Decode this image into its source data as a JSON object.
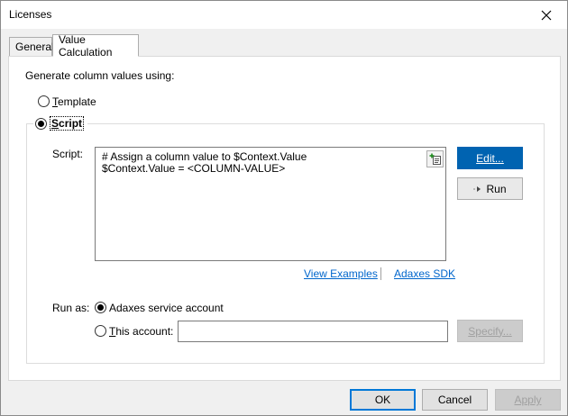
{
  "window": {
    "title": "Licenses"
  },
  "tabs": [
    {
      "label": "General",
      "active": false
    },
    {
      "label": "Value Calculation",
      "active": true
    }
  ],
  "generate": {
    "heading": "Generate column values using:",
    "options": [
      {
        "label": "Template",
        "checked": false
      },
      {
        "label": "Script",
        "checked": true
      }
    ]
  },
  "script": {
    "label": "Script:",
    "lines": [
      "# Assign a column value to $Context.Value",
      "$Context.Value = <COLUMN-VALUE>"
    ],
    "edit_label": "Edit...",
    "run_label": "Run",
    "links": {
      "view_examples": "View Examples",
      "sdk": "Adaxes SDK"
    }
  },
  "run_as": {
    "label": "Run as:",
    "options": [
      {
        "label": "Adaxes service account",
        "checked": true
      },
      {
        "label": "This account:",
        "checked": false
      }
    ],
    "account_value": "",
    "specify_label": "Specify..."
  },
  "footer": {
    "ok_label": "OK",
    "cancel_label": "Cancel",
    "apply_label": "Apply"
  },
  "colors": {
    "accent": "#0063b1",
    "link": "#0066cc",
    "focus_border": "#0078d7"
  }
}
